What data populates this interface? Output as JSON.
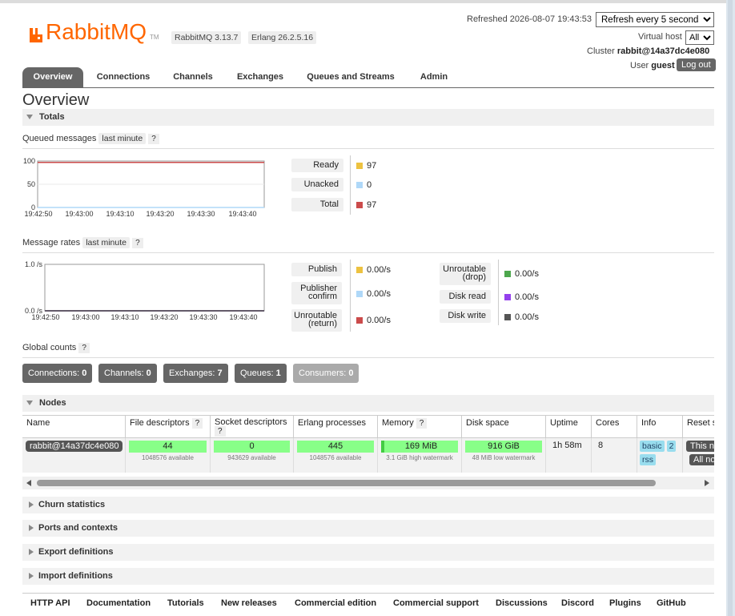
{
  "header": {
    "logo_text": "RabbitMQ",
    "logo_tm": "TM",
    "version_rabbit": "RabbitMQ 3.13.7",
    "version_erlang": "Erlang 26.2.5.16",
    "refreshed_label": "Refreshed 2026-08-07 19:43:53",
    "refresh_option": "Refresh every 5 seconds",
    "vhost_label": "Virtual host",
    "vhost_value": "All",
    "cluster_label": "Cluster",
    "cluster_name": "rabbit@14a37dc4e080",
    "user_label": "User",
    "user_name": "guest",
    "logout_label": "Log out"
  },
  "tabs": [
    "Overview",
    "Connections",
    "Channels",
    "Exchanges",
    "Queues and Streams",
    "Admin"
  ],
  "page_title": "Overview",
  "totals": {
    "title": "Totals",
    "queued_label": "Queued messages",
    "rates_label": "Message rates",
    "range_label": "last minute",
    "help": "?"
  },
  "queued_chart": {
    "y_ticks": [
      "100",
      "50",
      "0"
    ],
    "x_ticks": [
      "19:42:50",
      "19:43:00",
      "19:43:10",
      "19:43:20",
      "19:43:30",
      "19:43:40"
    ],
    "legend": [
      {
        "label": "Ready",
        "value": "97",
        "color": "#edc240"
      },
      {
        "label": "Unacked",
        "value": "0",
        "color": "#afd8f8"
      },
      {
        "label": "Total",
        "value": "97",
        "color": "#cb4b4b"
      }
    ]
  },
  "rates_chart": {
    "y_ticks": [
      "1.0 /s",
      "0.0 /s"
    ],
    "x_ticks": [
      "19:42:50",
      "19:43:00",
      "19:43:10",
      "19:43:20",
      "19:43:30",
      "19:43:40"
    ],
    "legend_left": [
      {
        "label": "Publish",
        "value": "0.00/s",
        "color": "#edc240"
      },
      {
        "label": "Publisher confirm",
        "value": "0.00/s",
        "color": "#afd8f8"
      },
      {
        "label": "Unroutable (return)",
        "value": "0.00/s",
        "color": "#cb4b4b"
      }
    ],
    "legend_right": [
      {
        "label": "Unroutable (drop)",
        "value": "0.00/s",
        "color": "#4da74d"
      },
      {
        "label": "Disk read",
        "value": "0.00/s",
        "color": "#9440ed"
      },
      {
        "label": "Disk write",
        "value": "0.00/s",
        "color": "#555555"
      }
    ]
  },
  "chart_data": [
    {
      "type": "line",
      "title": "Queued messages",
      "x": [
        "19:42:50",
        "19:43:00",
        "19:43:10",
        "19:43:20",
        "19:43:30",
        "19:43:40"
      ],
      "ylim": [
        0,
        100
      ],
      "series": [
        {
          "name": "Ready",
          "values": [
            97,
            97,
            97,
            97,
            97,
            97
          ]
        },
        {
          "name": "Unacked",
          "values": [
            0,
            0,
            0,
            0,
            0,
            0
          ]
        },
        {
          "name": "Total",
          "values": [
            97,
            97,
            97,
            97,
            97,
            97
          ]
        }
      ]
    },
    {
      "type": "line",
      "title": "Message rates",
      "x": [
        "19:42:50",
        "19:43:00",
        "19:43:10",
        "19:43:20",
        "19:43:30",
        "19:43:40"
      ],
      "ylim": [
        0,
        1
      ],
      "series": [
        {
          "name": "Publish",
          "values": [
            0,
            0,
            0,
            0,
            0,
            0
          ]
        },
        {
          "name": "Publisher confirm",
          "values": [
            0,
            0,
            0,
            0,
            0,
            0
          ]
        },
        {
          "name": "Unroutable (return)",
          "values": [
            0,
            0,
            0,
            0,
            0,
            0
          ]
        },
        {
          "name": "Unroutable (drop)",
          "values": [
            0,
            0,
            0,
            0,
            0,
            0
          ]
        },
        {
          "name": "Disk read",
          "values": [
            0,
            0,
            0,
            0,
            0,
            0
          ]
        },
        {
          "name": "Disk write",
          "values": [
            0,
            0,
            0,
            0,
            0,
            0
          ]
        }
      ]
    }
  ],
  "global_counts": {
    "label": "Global counts",
    "items": [
      {
        "label": "Connections:",
        "value": "0"
      },
      {
        "label": "Channels:",
        "value": "0"
      },
      {
        "label": "Exchanges:",
        "value": "7"
      },
      {
        "label": "Queues:",
        "value": "1"
      },
      {
        "label": "Consumers:",
        "value": "0"
      }
    ]
  },
  "nodes": {
    "title": "Nodes",
    "columns": [
      "Name",
      "File descriptors",
      "Socket descriptors",
      "Erlang processes",
      "Memory",
      "Disk space",
      "Uptime",
      "Cores",
      "Info",
      "Reset s"
    ],
    "row": {
      "name": "rabbit@14a37dc4e080",
      "file_desc": "44",
      "file_desc_sub": "1048576 available",
      "socket_desc": "0",
      "socket_desc_sub": "943629 available",
      "erlang_proc": "445",
      "erlang_proc_sub": "1048576 available",
      "memory": "169 MiB",
      "memory_sub": "3.1 GiB high watermark",
      "disk": "916 GiB",
      "disk_sub": "48 MiB low watermark",
      "uptime": "1h 58m",
      "cores": "8",
      "info_basic": "basic",
      "info_num": "2",
      "info_rss": "rss",
      "reset_1": "This n",
      "reset_2": "All no"
    }
  },
  "collapsed_sections": [
    "Churn statistics",
    "Ports and contexts",
    "Export definitions",
    "Import definitions"
  ],
  "footer_links": [
    "HTTP API",
    "Documentation",
    "Tutorials",
    "New releases",
    "Commercial edition",
    "Commercial support",
    "Discussions",
    "Discord",
    "Plugins",
    "GitHub"
  ]
}
